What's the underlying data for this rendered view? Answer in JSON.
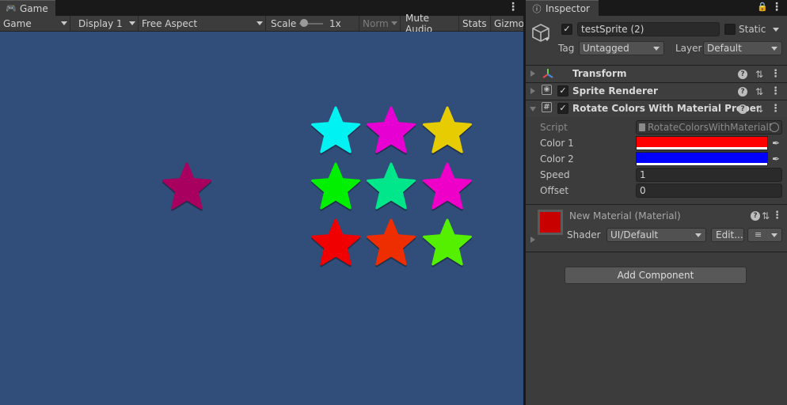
{
  "game_panel": {
    "tab_label": "Game",
    "toolbar": {
      "display_mode": "Game",
      "display": "Display 1",
      "aspect": "Free Aspect",
      "scale_label": "Scale",
      "scale_value": 0.0,
      "scale_text": "1x",
      "normal_label": "Norm",
      "mute_audio": "Mute Audio",
      "stats": "Stats",
      "gizmos": "Gizmo"
    },
    "background_color": "#314d79",
    "stars": [
      {
        "color": "#a8005e"
      },
      {
        "color": "#00f2f2"
      },
      {
        "color": "#e600d2"
      },
      {
        "color": "#e6cc00"
      },
      {
        "color": "#00f000"
      },
      {
        "color": "#00e68a"
      },
      {
        "color": "#ee00c8"
      },
      {
        "color": "#f00000"
      },
      {
        "color": "#ee2e00"
      },
      {
        "color": "#55f000"
      }
    ]
  },
  "inspector": {
    "tab_label": "Inspector",
    "object": {
      "name": "testSprite (2)",
      "active": true,
      "static_label": "Static",
      "tag_label": "Tag",
      "tag_value": "Untagged",
      "layer_label": "Layer",
      "layer_value": "Default"
    },
    "components": {
      "transform": {
        "title": "Transform"
      },
      "sprite_renderer": {
        "title": "Sprite Renderer",
        "enabled": true
      },
      "rotate_colors": {
        "title": "Rotate Colors With Material Proper",
        "enabled": true,
        "script_label": "Script",
        "script_value": "RotateColorsWithMaterialP",
        "color1_label": "Color 1",
        "color1": "#ff0000",
        "color2_label": "Color 2",
        "color2": "#0000ff",
        "speed_label": "Speed",
        "speed_value": "1",
        "offset_label": "Offset",
        "offset_value": "0"
      }
    },
    "material": {
      "title": "New Material (Material)",
      "preview_color": "#c80000",
      "shader_label": "Shader",
      "shader_value": "UI/Default",
      "edit_label": "Edit..."
    },
    "add_component_label": "Add Component"
  }
}
